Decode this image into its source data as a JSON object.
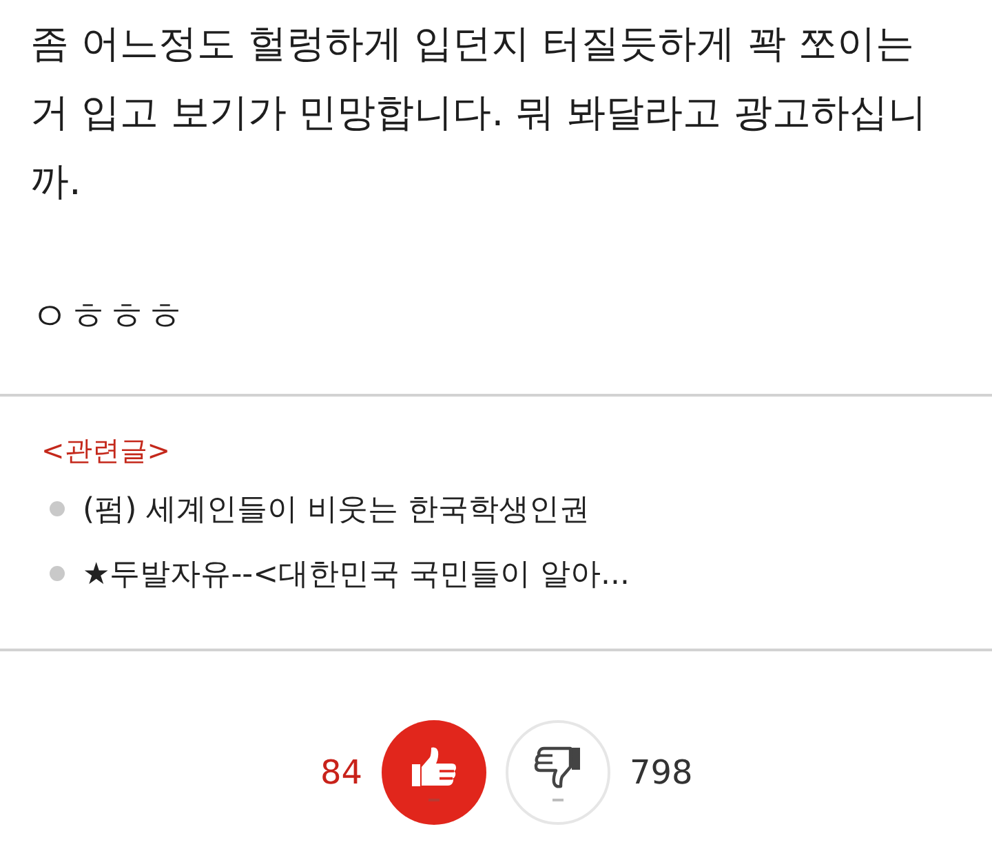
{
  "post": {
    "body": "좀 어느정도 헐렁하게 입던지 터질듯하게 꽉 쪼이는 거 입고 보기가 민망합니다. 뭐 봐달라고 광고하십니까.",
    "reaction": "ㅇㅎㅎㅎ"
  },
  "related": {
    "heading": "<관련글>",
    "items": [
      {
        "title": "(펌) 세계인들이 비웃는 한국학생인권"
      },
      {
        "title": "★두발자유--<대한민국 국민들이 알아..."
      }
    ]
  },
  "votes": [
    {
      "kind": "up",
      "count": "84"
    },
    {
      "kind": "down",
      "count": "798"
    }
  ]
}
